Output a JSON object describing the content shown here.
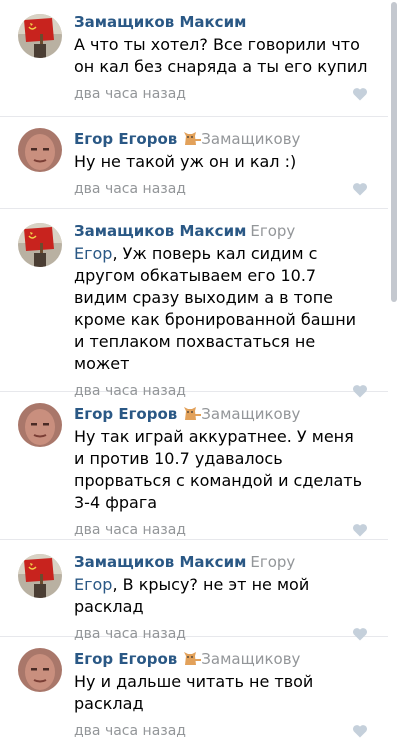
{
  "comments": [
    {
      "author": "Замащиков Максим",
      "reply_to": "",
      "mention": "",
      "text": "А что ты хотел? Все говорили что он кал без снаряда а ты его купил",
      "time": "два часа назад"
    },
    {
      "author": "Егор Егоров",
      "reply_to": "Замащикову",
      "mention": "",
      "text": "Ну не такой уж он и кал :)",
      "time": "два часа назад"
    },
    {
      "author": "Замащиков Максим",
      "reply_to": "Егору",
      "mention": "Егор",
      "text": ", Уж поверь кал сидим с другом обкатываем его 10.7 видим сразу выходим а в топе кроме как бронированной башни и теплаком похвастаться не может",
      "time": "два часа назад"
    },
    {
      "author": "Егор Егоров",
      "reply_to": "Замащикову",
      "mention": "",
      "text": "Ну так играй аккуратнее. У меня и против 10.7 удавалось прорваться с командой и сделать 3-4 фрага",
      "time": "два часа назад"
    },
    {
      "author": "Замащиков Максим",
      "reply_to": "Егору",
      "mention": "Егор",
      "text": ", В крысу? не эт не мой расклад",
      "time": "два часа назад"
    },
    {
      "author": "Егор Егоров",
      "reply_to": "Замащикову",
      "mention": "",
      "text": "Ну и дальше читать не твой расклад",
      "time": "два часа назад"
    }
  ],
  "icons": {
    "like": "heart-icon",
    "reply_marker": "cat-icon",
    "avatar_maksim": "soviet-flag-avatar",
    "avatar_egor": "face-photo-avatar"
  },
  "colors": {
    "link": "#2a5885",
    "muted": "#939699",
    "like": "#c5d0db",
    "flag_red": "#c8231e"
  }
}
